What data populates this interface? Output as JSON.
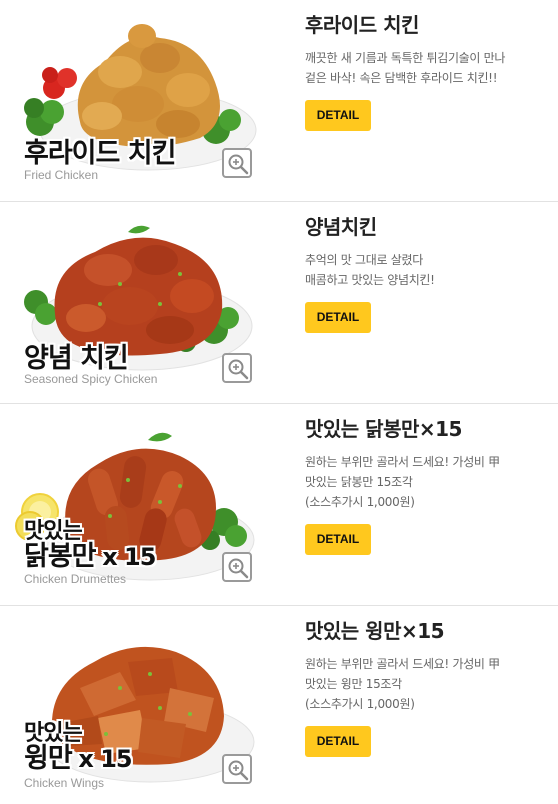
{
  "items": [
    {
      "photo_title": "후라이드 치킨",
      "photo_subtitle": "Fried Chicken",
      "name": "후라이드 치킨",
      "desc_lines": [
        "깨끗한 새 기름과 독특한 튀김기술이 만나",
        "겉은 바삭! 속은 담백한 후라이드 치킨!!"
      ],
      "detail_label": "DETAIL",
      "sauce_color": "#d79a3a"
    },
    {
      "photo_title": "양념 치킨",
      "photo_subtitle": "Seasoned Spicy Chicken",
      "name": "양념치킨",
      "desc_lines": [
        "추억의 맛 그대로 살렸다",
        "매콤하고 맛있는 양념치킨!"
      ],
      "detail_label": "DETAIL",
      "sauce_color": "#b8421f"
    },
    {
      "photo_title_line1": "맛있는",
      "photo_title_line2": "닭봉만",
      "photo_title_mult": "x 15",
      "photo_subtitle": "Chicken Drumettes",
      "name": "맛있는 닭봉만×15",
      "desc_lines": [
        "원하는 부위만 골라서 드세요! 가성비 甲",
        "맛있는 닭봉만 15조각",
        "(소스추가시 1,000원)"
      ],
      "detail_label": "DETAIL",
      "sauce_color": "#b9471f"
    },
    {
      "photo_title_line1": "맛있는",
      "photo_title_line2": "윙만",
      "photo_title_mult": "x 15",
      "photo_subtitle": "Chicken Wings",
      "name": "맛있는 윙만×15",
      "desc_lines": [
        "원하는 부위만 골라서 드세요! 가성비 甲",
        "맛있는 윙만 15조각",
        "(소스추가시 1,000원)"
      ],
      "detail_label": "DETAIL",
      "sauce_color": "#c0531f"
    }
  ],
  "icons": {
    "zoom": "magnifier-plus-icon",
    "parsley": "parsley-garnish-icon",
    "tomato": "cherry-tomato-icon",
    "lemon": "lemon-slice-icon"
  },
  "colors": {
    "detail_button": "#ffc81e",
    "divider": "#e2e2e2",
    "name_text": "#222222",
    "desc_text": "#666666",
    "subtitle_text": "#999999"
  }
}
